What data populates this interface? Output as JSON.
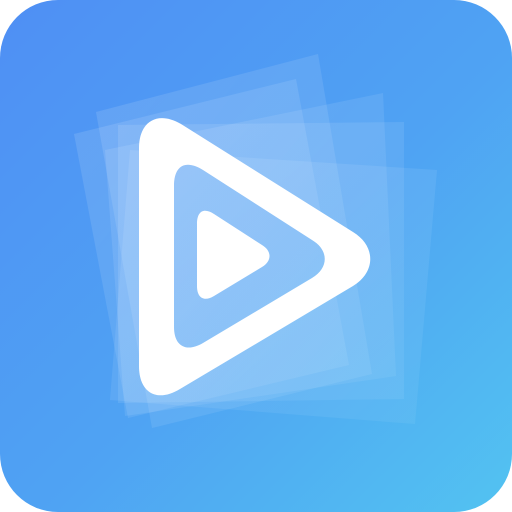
{
  "icon": {
    "name": "video-player-app-icon",
    "symbol": "play-icon",
    "colors": {
      "gradient_start": "#4f8ff4",
      "gradient_mid": "#4fa3f3",
      "gradient_end": "#52c3f1",
      "card_overlay": "#ffffff",
      "play_outline": "#ffffff",
      "inner_play": "#ffffff"
    }
  }
}
